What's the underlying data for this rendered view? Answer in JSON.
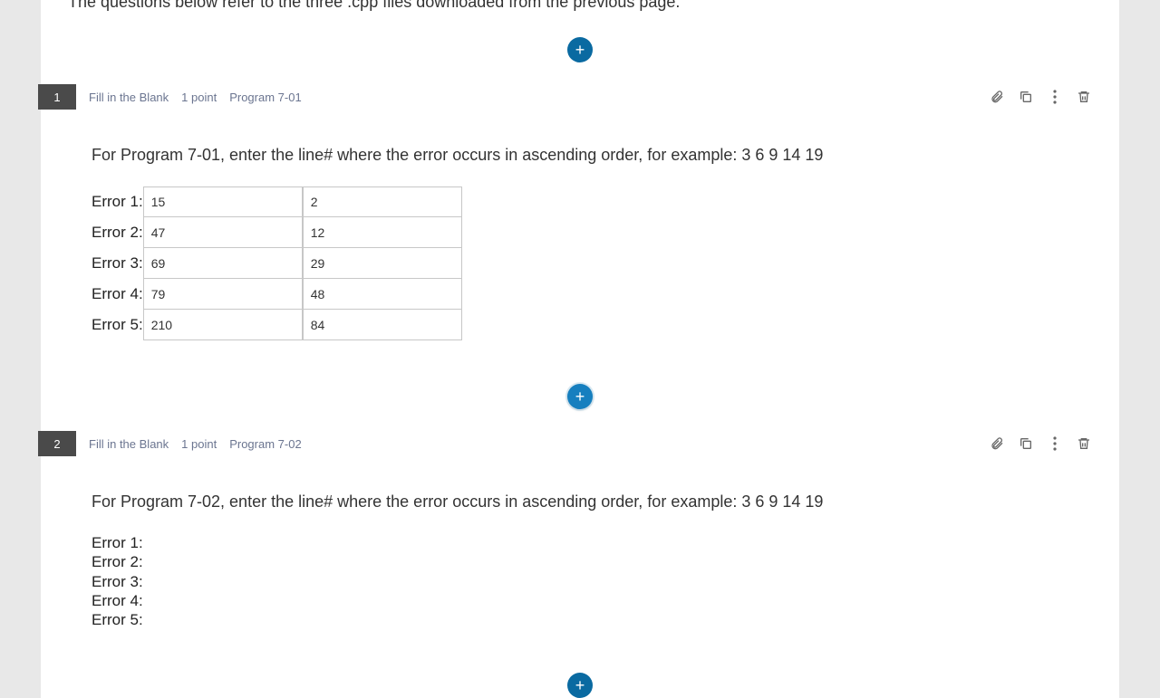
{
  "intro": "The questions below refer to the three .cpp files downloaded from the previous page.",
  "add_glyph": "+",
  "questions": [
    {
      "number": "1",
      "type": "Fill in the Blank",
      "points": "1 point",
      "tag": "Program 7-01",
      "prompt": "For Program 7-01, enter the line# where the error occurs in ascending order, for example: 3 6 9 14 19",
      "rows": [
        {
          "label": "Error 1:",
          "a": "15",
          "b": "2"
        },
        {
          "label": "Error 2:",
          "a": "47",
          "b": "12"
        },
        {
          "label": "Error 3:",
          "a": "69",
          "b": "29"
        },
        {
          "label": "Error 4:",
          "a": "79",
          "b": "48"
        },
        {
          "label": "Error 5:",
          "a": "210",
          "b": "84"
        }
      ]
    },
    {
      "number": "2",
      "type": "Fill in the Blank",
      "points": "1 point",
      "tag": "Program 7-02",
      "prompt": "For Program 7-02, enter the line# where the error occurs in ascending order, for example: 3 6 9 14 19",
      "lines": [
        "Error 1:",
        "Error 2:",
        "Error 3:",
        "Error 4:",
        "Error 5:"
      ]
    }
  ]
}
